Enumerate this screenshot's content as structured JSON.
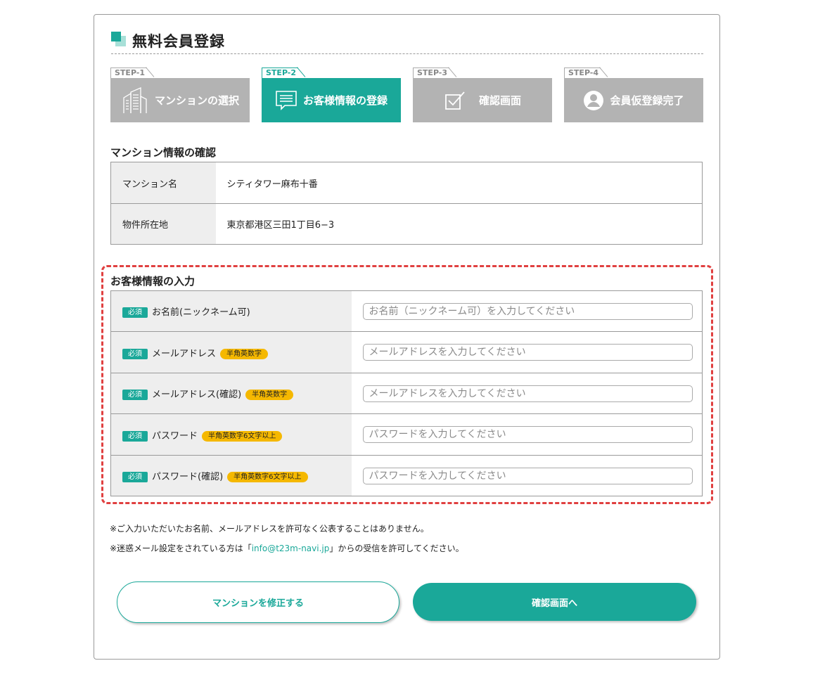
{
  "page_title": "無料会員登録",
  "steps": [
    {
      "tab": "STEP-1",
      "label": "マンションの選択",
      "icon": "building-icon",
      "active": false
    },
    {
      "tab": "STEP-2",
      "label": "お客様情報の登録",
      "icon": "form-icon",
      "active": true
    },
    {
      "tab": "STEP-3",
      "label": "確認画面",
      "icon": "checkbox-icon",
      "active": false
    },
    {
      "tab": "STEP-4",
      "label": "会員仮登録完了",
      "icon": "user-icon",
      "active": false
    }
  ],
  "mansion_section": {
    "title": "マンション情報の確認",
    "rows": [
      {
        "label": "マンション名",
        "value": "シティタワー麻布十番"
      },
      {
        "label": "物件所在地",
        "value": "東京都港区三田1丁目6−3"
      }
    ]
  },
  "customer_section": {
    "title": "お客様情報の入力",
    "required_label": "必須",
    "fields": [
      {
        "label": "お名前(ニックネーム可)",
        "badge": "",
        "placeholder": "お名前（ニックネーム可）を入力してください",
        "value": ""
      },
      {
        "label": "メールアドレス",
        "badge": "半角英数字",
        "placeholder": "メールアドレスを入力してください",
        "value": ""
      },
      {
        "label": "メールアドレス(確認)",
        "badge": "半角英数字",
        "placeholder": "メールアドレスを入力してください",
        "value": ""
      },
      {
        "label": "パスワード",
        "badge": "半角英数字6文字以上",
        "placeholder": "パスワードを入力してください",
        "value": ""
      },
      {
        "label": "パスワード(確認)",
        "badge": "半角英数字6文字以上",
        "placeholder": "パスワードを入力してください",
        "value": ""
      }
    ]
  },
  "notes": {
    "line1": "※ご入力いただいたお名前、メールアドレスを許可なく公表することはありません。",
    "line2_prefix": "※迷惑メール設定をされている方は「",
    "line2_link": "info@t23m-navi.jp",
    "line2_suffix": "」からの受信を許可してください。"
  },
  "buttons": {
    "back": "マンションを修正する",
    "next": "確認画面へ"
  },
  "colors": {
    "accent": "#1aa899",
    "step_inactive": "#b3b3b3",
    "badge": "#f5b800",
    "highlight": "#e04040"
  }
}
